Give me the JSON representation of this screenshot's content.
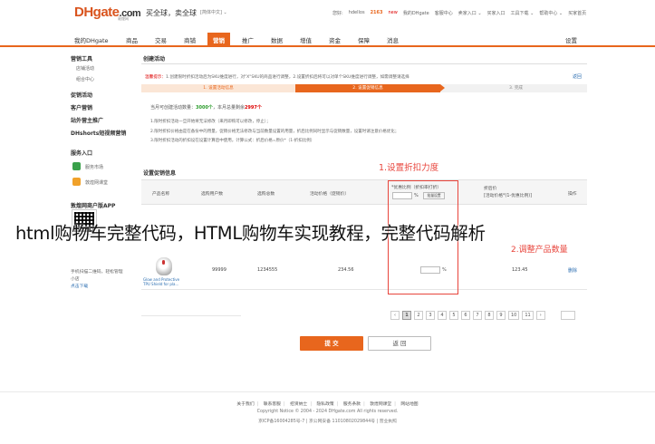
{
  "header": {
    "logo_main": "DHgate",
    "logo_suffix": ".com",
    "logo_sub": "敦煌网",
    "slogan": "买全球，卖全球",
    "language": "[简体中文] ⌄",
    "links": {
      "greeting": "您好:",
      "username": "hdellos",
      "orange_id": "2163",
      "msg_label": "new",
      "links_list": [
        "我的DHgate",
        "客服中心",
        "卖家入口 ⌄",
        "买家入口",
        "工具下载 ⌄",
        "帮助中心 ⌄",
        "买家首页"
      ]
    }
  },
  "nav": {
    "items": [
      "我的DHgate",
      "商品",
      "交易",
      "商铺",
      "营销",
      "推广",
      "数据",
      "增值",
      "资金",
      "保障",
      "消息"
    ],
    "active_index": 4,
    "settings": "设置"
  },
  "sidebar": {
    "groups": [
      {
        "title": "营销工具",
        "items": [
          "店铺活动",
          "组合中心"
        ]
      },
      {
        "title": "促销活动",
        "items": []
      },
      {
        "title": "客户营销",
        "items": []
      },
      {
        "title": "站外营主推广",
        "items": []
      },
      {
        "title": "DHshorts短视频营销",
        "items": []
      },
      {
        "title": "服务入口",
        "items": [
          "服务市场",
          "敦煌网课堂"
        ]
      },
      {
        "title": "敦煌网商户版APP",
        "items": []
      }
    ],
    "qr_caption_1": "手机扫描二维码，轻松管理",
    "qr_caption_2": "小店",
    "qr_link": "点击下载"
  },
  "content": {
    "title": "创建活动",
    "tip_prefix": "温馨提示：",
    "tip_text": "1.创建限时折扣活动后为SKU维度进行，对\"X\"SKU的商品进行调整，2.设置折扣后将可以对单个SKU维度进行调整，如需调整请选择",
    "back_link": "返回",
    "steps": [
      "1. 设置活动信息",
      "2. 设置促销信息",
      "3. 完成"
    ],
    "count_prefix": "当月可创建活动数量：",
    "count_value": "3000个",
    "count_middle": "，本月总量剩余",
    "count_remaining": "2997个",
    "rules": [
      "1.限时折扣活动一旦开始将无法修改（来月即购可以修改，停止）；",
      "2.限时折扣价格由是在备份中的用量，促销价格无法修改与当前数量设置的用量，折后比例同时显示与促销数量，设置时请注意价格优化；",
      "3.限时折扣活动的折扣设在设置计算后中使用，计算公式：折后价格=原价*（1-折扣比例）"
    ],
    "section_promo": "设置促销信息"
  },
  "annotations": {
    "a1": "1.设置折扣力度",
    "a2": "2.调整产品数量"
  },
  "table": {
    "headers": [
      "产品名称",
      "选购用户数",
      "选购总数",
      "活动价格（促销价）",
      "*优惠比例（折扣率打折）",
      "折后价",
      "操作"
    ],
    "header_final_price_sub": "[活动价格*(1-优惠比例)]",
    "batch_button": "批量设置",
    "percent": "%",
    "row": {
      "name_line1": "Glow and Protective",
      "name_line2": "TPU Shield for pla...",
      "buyers": "99999",
      "total": "1234555",
      "price": "234.56",
      "final": "123.45",
      "action": "删除"
    }
  },
  "pager": {
    "prev": "‹",
    "pages": [
      "1",
      "2",
      "3",
      "4",
      "5",
      "6",
      "7",
      "8",
      "9",
      "10",
      "11"
    ],
    "next": "›",
    "current": "1"
  },
  "buttons": {
    "submit": "提 交",
    "back": "返 回"
  },
  "overlay": {
    "text": "html购物车完整代码，HTML购物车实现教程，完整代码解析"
  },
  "footer": {
    "links": [
      "关于我们",
      "联系客服",
      "招贤纳士",
      "隐私政策",
      "服务条款",
      "敦煌网课堂",
      "网站地图"
    ],
    "copyright": "Copyright Notice © 2004 - 2024 DHgate.com All rights reserved.",
    "license": "京ICP备16004285号-7 | 京公网安备 11010802029844号 | 营业执照"
  },
  "colors": {
    "accent": "#e8661d",
    "annotation": "#e8453c",
    "link": "#2a6db0"
  }
}
